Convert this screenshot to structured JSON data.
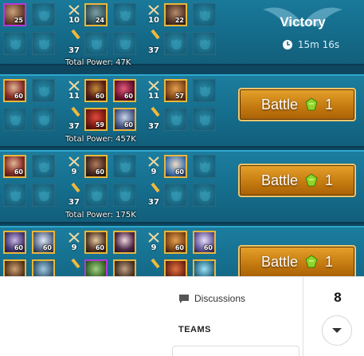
{
  "rows": [
    {
      "left_team_stat_top": "10",
      "left_team_stat_bottom": "37",
      "right_team_stat_top": "10",
      "right_team_stat_bottom": "37",
      "power_text": "Total Power: 47K",
      "champion_levels": [
        "25",
        "24",
        "22"
      ],
      "result": {
        "title": "Victory",
        "time": "15m 16s"
      }
    },
    {
      "left_team_stat_top": "11",
      "left_team_stat_bottom": "37",
      "right_team_stat_top": "11",
      "right_team_stat_bottom": "37",
      "power_text": "Total Power: 457K",
      "champion_levels": [
        "60",
        "60",
        "60",
        "57",
        "59",
        "60"
      ],
      "battle_label": "Battle",
      "battle_cost": "1"
    },
    {
      "left_team_stat_top": "9",
      "left_team_stat_bottom": "37",
      "right_team_stat_top": "9",
      "right_team_stat_bottom": "37",
      "power_text": "Total Power: 175K",
      "champion_levels": [
        "60",
        "60",
        "60"
      ],
      "battle_label": "Battle",
      "battle_cost": "1"
    },
    {
      "left_team_stat_top": "9",
      "left_team_stat_bottom": "",
      "right_team_stat_top": "9",
      "right_team_stat_bottom": "",
      "power_text": "",
      "champion_levels": [
        "60",
        "60",
        "60",
        "60",
        "60"
      ],
      "battle_label": "Battle",
      "battle_cost": "1"
    }
  ],
  "page": {
    "discussions_label": "Discussions",
    "teams_heading": "TEAMS",
    "count": "8"
  },
  "colors": {
    "row_bg": "#156d8c",
    "battle_button": "#c67c10",
    "legendary_border": "#e9b63a",
    "epic_border": "#b43ad6"
  },
  "icons": [
    "crossed-swords-icon",
    "key-icon",
    "gem-icon",
    "clock-icon",
    "empty-slot-helmet-icon",
    "chat-bubble-icon",
    "chevron-down-icon"
  ]
}
